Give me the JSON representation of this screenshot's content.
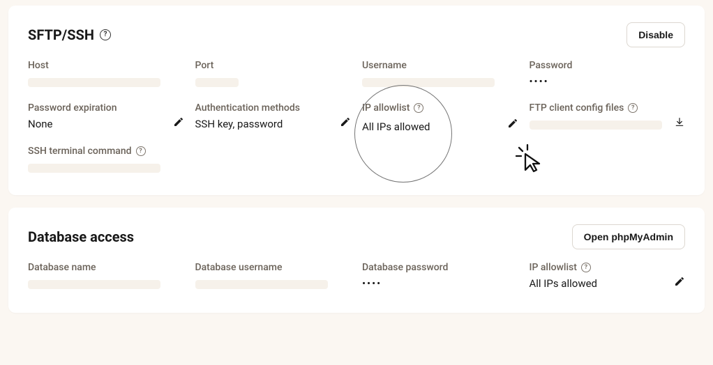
{
  "sftp": {
    "title": "SFTP/SSH",
    "disable_btn": "Disable",
    "labels": {
      "host": "Host",
      "port": "Port",
      "username": "Username",
      "password": "Password",
      "password_expiration": "Password expiration",
      "auth_methods": "Authentication methods",
      "ip_allowlist": "IP allowlist",
      "ftp_client_config": "FTP client config files",
      "ssh_terminal_command": "SSH terminal command"
    },
    "values": {
      "password": "••••",
      "password_expiration": "None",
      "auth_methods": "SSH key, password",
      "ip_allowlist": "All IPs allowed"
    }
  },
  "db": {
    "title": "Database access",
    "open_btn": "Open phpMyAdmin",
    "labels": {
      "database_name": "Database name",
      "database_username": "Database username",
      "database_password": "Database password",
      "ip_allowlist": "IP allowlist"
    },
    "values": {
      "database_password": "••••",
      "ip_allowlist": "All IPs allowed"
    }
  }
}
